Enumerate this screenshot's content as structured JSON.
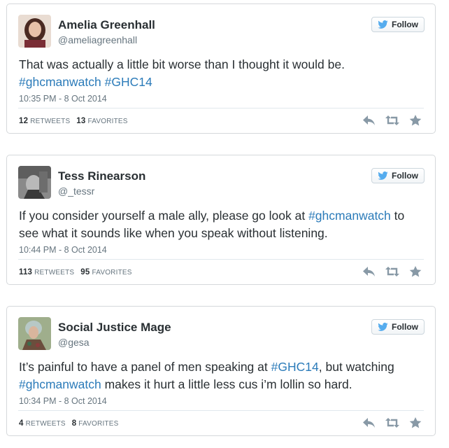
{
  "follow_label": "Follow",
  "tweets": [
    {
      "name": "Amelia Greenhall",
      "handle": "@ameliagreenhall",
      "text_parts": [
        "That was actually a little bit worse than I thought it would be.",
        "#ghcmanwatch",
        "#GHC14"
      ],
      "date": "10:35 PM - 8 Oct 2014",
      "retweets": "12",
      "retweets_label": "RETWEETS",
      "favorites": "13",
      "favorites_label": "FAVORITES"
    },
    {
      "name": "Tess Rinearson",
      "handle": "@_tessr",
      "text_parts": [
        "If you consider yourself a male ally, please go look at",
        "#ghcmanwatch",
        "to see what it sounds like when you speak without listening."
      ],
      "date": "10:44 PM - 8 Oct 2014",
      "retweets": "113",
      "retweets_label": "RETWEETS",
      "favorites": "95",
      "favorites_label": "FAVORITES"
    },
    {
      "name": "Social Justice Mage",
      "handle": "@gesa",
      "text_parts": [
        "It’s painful to have a panel of men speaking at",
        "#GHC14",
        ", but watching",
        "#ghcmanwatch",
        "makes it hurt a little less cus i’m lollin so hard."
      ],
      "date": "10:34 PM - 8 Oct 2014",
      "retweets": "4",
      "retweets_label": "RETWEETS",
      "favorites": "8",
      "favorites_label": "FAVORITES"
    }
  ],
  "icons": {
    "bird": "twitter-bird-icon",
    "reply": "reply-icon",
    "retweet": "retweet-icon",
    "favorite": "star-icon"
  },
  "colors": {
    "hashtag": "#2b7bb9",
    "bird": "#55acee",
    "muted": "#66757f",
    "action_icon": "#8899a6"
  }
}
